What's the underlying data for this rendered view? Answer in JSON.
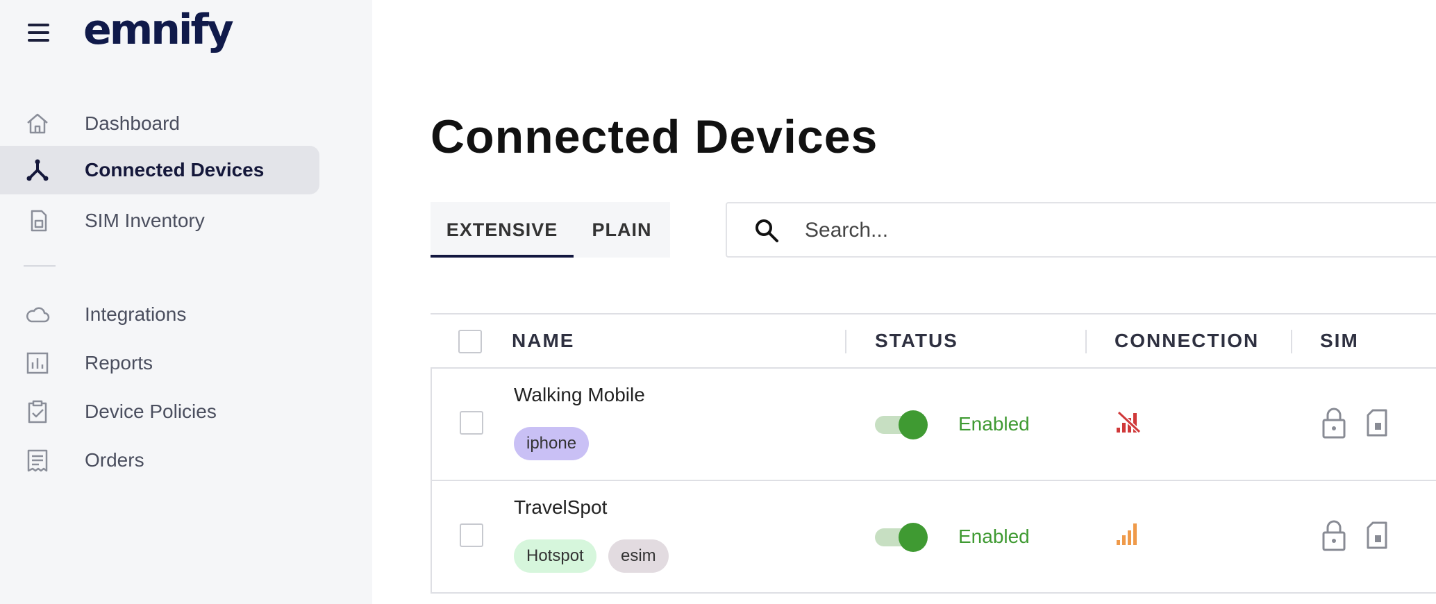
{
  "app": {
    "logo": "emnify"
  },
  "sidebar": {
    "items": [
      {
        "label": "Dashboard",
        "icon": "home-icon"
      },
      {
        "label": "Connected Devices",
        "icon": "network-icon",
        "active": true
      },
      {
        "label": "SIM Inventory",
        "icon": "sim-card-icon"
      },
      {
        "label": "Integrations",
        "icon": "cloud-icon"
      },
      {
        "label": "Reports",
        "icon": "bar-chart-icon"
      },
      {
        "label": "Device Policies",
        "icon": "clipboard-check-icon"
      },
      {
        "label": "Orders",
        "icon": "receipt-icon"
      }
    ]
  },
  "main": {
    "title": "Connected Devices",
    "tabs": [
      {
        "label": "EXTENSIVE",
        "active": true
      },
      {
        "label": "PLAIN",
        "active": false
      }
    ],
    "search": {
      "placeholder": "Search...",
      "value": ""
    }
  },
  "table": {
    "columns": [
      "NAME",
      "STATUS",
      "CONNECTION",
      "SIM"
    ],
    "rows": [
      {
        "name": "Walking Mobile",
        "tags": [
          {
            "label": "iphone",
            "color": "#c9c0f5"
          }
        ],
        "enabled": true,
        "status": "Enabled",
        "connection": "no-signal",
        "connection_color": "#d0393a"
      },
      {
        "name": "TravelSpot",
        "tags": [
          {
            "label": "Hotspot",
            "color": "#d6f6dc"
          },
          {
            "label": "esim",
            "color": "#e2dbe0"
          }
        ],
        "enabled": true,
        "status": "Enabled",
        "connection": "signal",
        "connection_color": "#ef9a4a"
      }
    ]
  },
  "colors": {
    "accent": "#12173f",
    "enabled": "#3f9a32",
    "sidebar_bg": "#f5f6f8"
  }
}
